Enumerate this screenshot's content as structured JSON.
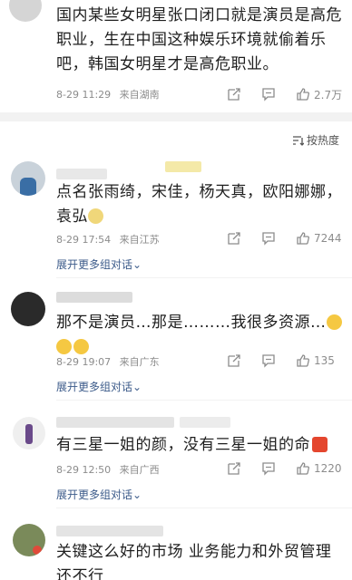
{
  "post": {
    "text": "国内某些女明星张口闭口就是演员是高危职业，生在中国这种娱乐环境就偷着乐吧，韩国女明星才是高危职业。",
    "date": "8-29 11:29",
    "location": "来自湖南",
    "likes": "2.7万"
  },
  "sort": {
    "label": "按热度"
  },
  "comments": [
    {
      "text": "点名张雨绮，宋佳，杨天真，欧阳娜娜，袁弘",
      "date": "8-29 17:54",
      "location": "来自江苏",
      "likes": "7244",
      "expand": "展开更多组对话"
    },
    {
      "text": "那不是演员…那是………我很多资源…",
      "date": "8-29 19:07",
      "location": "来自广东",
      "likes": "135",
      "expand": "展开更多组对话"
    },
    {
      "text": "有三星一姐的颜，没有三星一姐的命",
      "date": "8-29 12:50",
      "location": "来自广西",
      "likes": "1220",
      "expand": "展开更多组对话"
    },
    {
      "text": "关键这么好的市场 业务能力和外贸管理还不行",
      "date": "",
      "location": "",
      "likes": "",
      "expand": ""
    }
  ],
  "colors": {
    "link": "#3c5b8a",
    "meta": "#8c8c8c",
    "divider": "#f2f2f2"
  }
}
